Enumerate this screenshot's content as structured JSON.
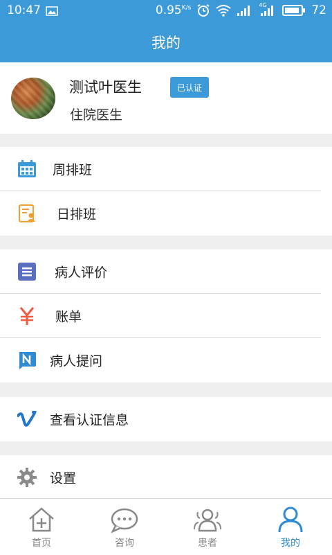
{
  "status_bar": {
    "time": "10:47",
    "speed": "0.95",
    "speed_unit": "K/s",
    "signal_label": "4G",
    "battery": "72"
  },
  "title": "我的",
  "profile": {
    "name": "测试叶医生",
    "badge": "已认证",
    "role": "住院医生"
  },
  "menu_groups": [
    [
      {
        "label": "周排班",
        "icon": "calendar-icon"
      },
      {
        "label": "日排班",
        "icon": "schedule-doc-icon"
      }
    ],
    [
      {
        "label": "病人评价",
        "icon": "list-icon"
      },
      {
        "label": "账单",
        "icon": "yen-icon"
      },
      {
        "label": "病人提问",
        "icon": "n-chat-icon"
      }
    ],
    [
      {
        "label": "查看认证信息",
        "icon": "vimeo-v-icon"
      }
    ],
    [
      {
        "label": "设置",
        "icon": "gear-icon"
      }
    ]
  ],
  "tabs": [
    {
      "label": "首页",
      "icon": "home-icon",
      "active": false
    },
    {
      "label": "咨询",
      "icon": "chat-bubble-icon",
      "active": false
    },
    {
      "label": "患者",
      "icon": "patients-icon",
      "active": false
    },
    {
      "label": "我的",
      "icon": "person-icon",
      "active": true
    }
  ],
  "colors": {
    "primary": "#3c9ad9",
    "active_tab": "#2f8bd4",
    "icon_calendar": "#3c9ad9",
    "icon_schedule": "#f0a030",
    "icon_list": "#5a6fc0",
    "icon_yen": "#f05a40",
    "icon_n": "#2f8bd4",
    "icon_v": "#2277c8",
    "icon_gear": "#8a8a8a"
  }
}
